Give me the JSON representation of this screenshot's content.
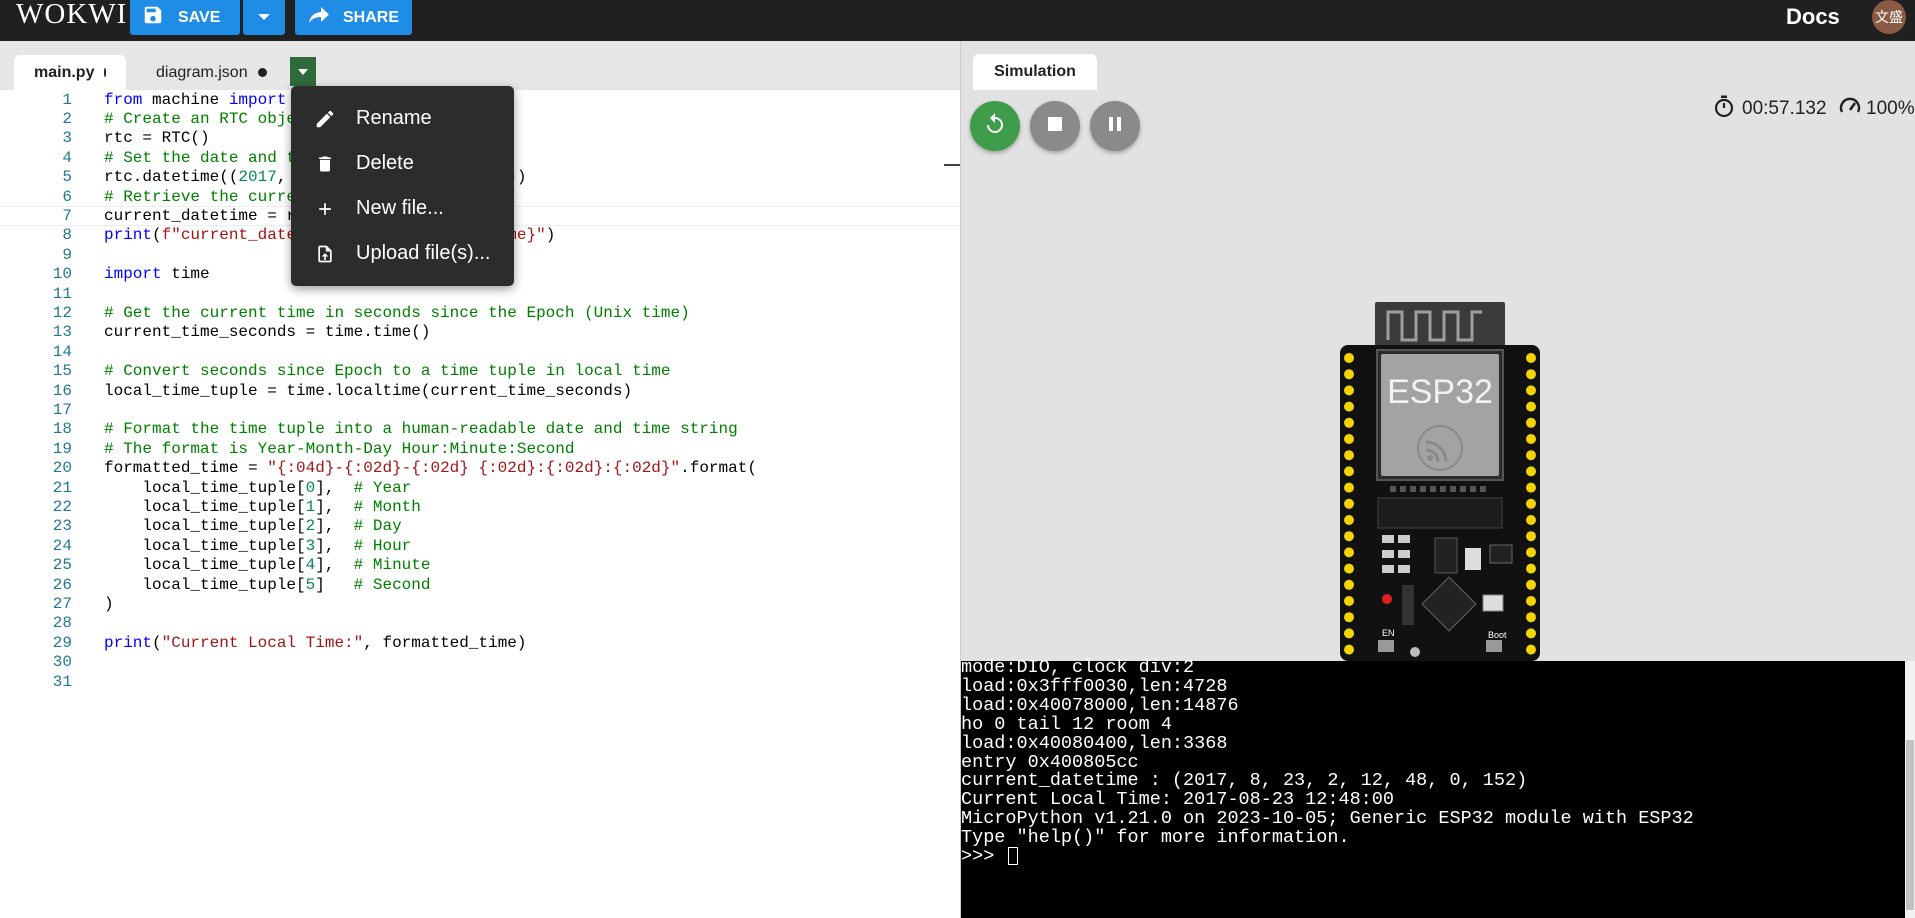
{
  "app": {
    "logo": "WOKWI",
    "save_label": "SAVE",
    "share_label": "SHARE",
    "docs_label": "Docs",
    "avatar_text": "文盛"
  },
  "editor": {
    "tabs": [
      {
        "label": "main.py",
        "active": true,
        "modified": true
      },
      {
        "label": "diagram.json",
        "active": false,
        "modified": true
      }
    ],
    "current_line": 7,
    "lines": [
      "from machine import RTC",
      "# Create an RTC object",
      "rtc = RTC()",
      "# Set the date and time",
      "rtc.datetime((2017, 8, 23, 2, 12, 48, 0, 0))",
      "# Retrieve the current date and time",
      "current_datetime = rtc.datetime()",
      "print(f\"current_datetime : {current_datetime}\")",
      "",
      "import time",
      "",
      "# Get the current time in seconds since the Epoch (Unix time)",
      "current_time_seconds = time.time()",
      "",
      "# Convert seconds since Epoch to a time tuple in local time",
      "local_time_tuple = time.localtime(current_time_seconds)",
      "",
      "# Format the time tuple into a human-readable date and time string",
      "# The format is Year-Month-Day Hour:Minute:Second",
      "formatted_time = \"{:04d}-{:02d}-{:02d} {:02d}:{:02d}:{:02d}\".format(",
      "    local_time_tuple[0],  # Year",
      "    local_time_tuple[1],  # Month",
      "    local_time_tuple[2],  # Day",
      "    local_time_tuple[3],  # Hour",
      "    local_time_tuple[4],  # Minute",
      "    local_time_tuple[5]   # Second",
      ")",
      "",
      "print(\"Current Local Time:\", formatted_time)",
      "",
      ""
    ]
  },
  "context_menu": {
    "items": [
      {
        "label": "Rename",
        "icon": "pencil-icon"
      },
      {
        "label": "Delete",
        "icon": "trash-icon"
      },
      {
        "label": "New file...",
        "icon": "plus-icon"
      },
      {
        "label": "Upload file(s)...",
        "icon": "upload-file-icon"
      }
    ]
  },
  "simulation": {
    "tab_label": "Simulation",
    "elapsed": "00:57.132",
    "speed": "100%",
    "board_label": "ESP32",
    "board_buttons": [
      "EN",
      "Boot"
    ],
    "controls": [
      {
        "name": "restart",
        "color": "#3e9c4a"
      },
      {
        "name": "stop",
        "color": "#8a8a8a"
      },
      {
        "name": "pause",
        "color": "#8a8a8a"
      }
    ]
  },
  "console": {
    "lines": [
      "mode:DIO, clock div:2",
      "load:0x3fff0030,len:4728",
      "load:0x40078000,len:14876",
      "ho 0 tail 12 room 4",
      "load:0x40080400,len:3368",
      "entry 0x400805cc",
      "current_datetime : (2017, 8, 23, 2, 12, 48, 0, 152)",
      "Current Local Time: 2017-08-23 12:48:00",
      "MicroPython v1.21.0 on 2023-10-05; Generic ESP32 module with ESP32",
      "Type \"help()\" for more information.",
      ">>> "
    ]
  }
}
